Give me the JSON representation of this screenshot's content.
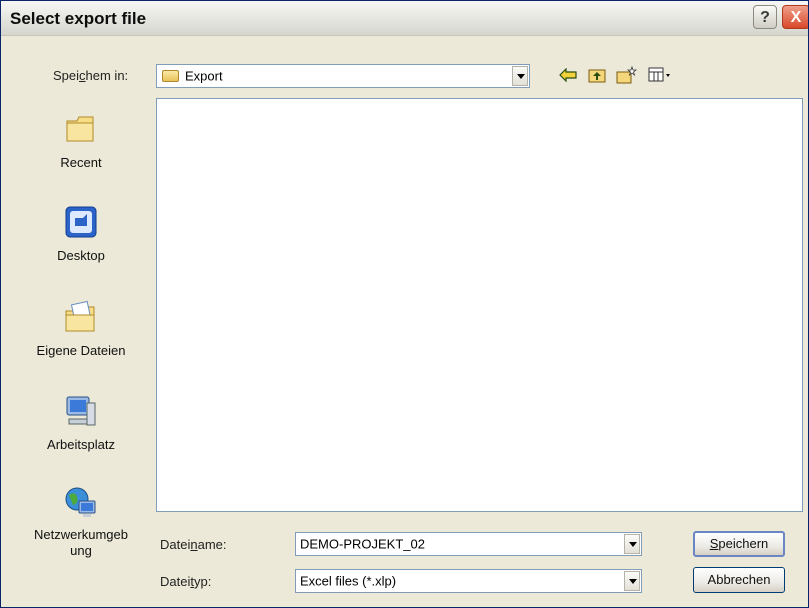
{
  "window": {
    "title": "Select export file"
  },
  "titlebar": {
    "help": "?",
    "close": "X"
  },
  "lookin": {
    "label_pre": "Spei",
    "label_key": "c",
    "label_post": "hem in:",
    "value": "Export"
  },
  "places": [
    {
      "label": "Recent",
      "icon": "recent-folder-icon"
    },
    {
      "label": "Desktop",
      "icon": "desktop-icon"
    },
    {
      "label": "Eigene Dateien",
      "icon": "my-documents-icon"
    },
    {
      "label": "Arbeitsplatz",
      "icon": "my-computer-icon"
    },
    {
      "label": "Netzwerkumgebung",
      "label_line2": "ung",
      "label_line1": "Netzwerkumgeb",
      "icon": "network-icon"
    }
  ],
  "filename": {
    "label_pre": "Datei",
    "label_key": "n",
    "label_post": "ame:",
    "value": "DEMO-PROJEKT_02"
  },
  "filetype": {
    "label_pre": "Datei",
    "label_key": "t",
    "label_post": "yp:",
    "value": "Excel files (*.xlp)"
  },
  "buttons": {
    "save_key": "S",
    "save_rest": "peichern",
    "cancel": "Abbrechen"
  },
  "colors": {
    "title_bar": "#e3e3dd",
    "close": "#d8482a",
    "border": "#7f9db9"
  }
}
